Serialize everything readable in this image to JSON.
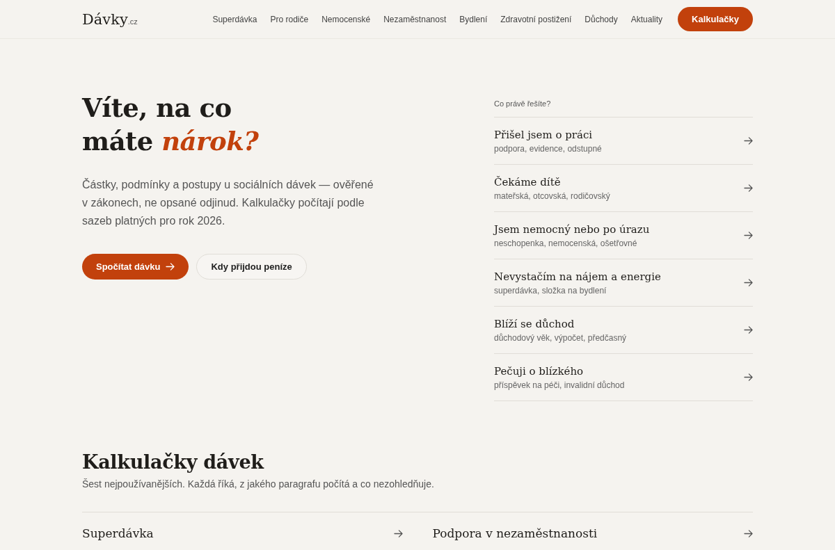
{
  "header": {
    "logo": "Dávky",
    "logo_suffix": ".cz",
    "nav": [
      {
        "label": "Superdávka",
        "kind": "link"
      },
      {
        "label": "Pro rodiče",
        "kind": "link"
      },
      {
        "label": "Nemocenské",
        "kind": "link"
      },
      {
        "label": "Nezaměstnanost",
        "kind": "link"
      },
      {
        "label": "Bydlení",
        "kind": "link"
      },
      {
        "label": "Zdravotní postižení",
        "kind": "link"
      },
      {
        "label": "Důchody",
        "kind": "link"
      },
      {
        "label": "Aktuality",
        "kind": "link"
      },
      {
        "label": "Kalkulačky",
        "kind": "cta"
      }
    ]
  },
  "hero": {
    "title": "Víte, na co máte *nárok?*",
    "lead": "Částky, podmínky a postupy u sociálních dávek — ověřené v zákonech, ne opsané odjinud. Kalkulačky počítají podle sazeb platných pro rok 2026.",
    "buttons": [
      {
        "label": "Spočítat dávku",
        "kind": "primary"
      },
      {
        "label": "Kdy přijdou peníze",
        "kind": "secondary"
      }
    ]
  },
  "situations": {
    "heading": "Co právě řešíte?",
    "items": [
      {
        "title": "Přišel jsem o práci",
        "tags": "podpora, evidence, odstupné"
      },
      {
        "title": "Čekáme dítě",
        "tags": "mateřská, otcovská, rodičovský"
      },
      {
        "title": "Jsem nemocný nebo po úrazu",
        "tags": "neschopenka, nemocenská, ošetřovné"
      },
      {
        "title": "Nevystačím na nájem a energie",
        "tags": "superdávka, složka na bydlení"
      },
      {
        "title": "Blíží se důchod",
        "tags": "důchodový věk, výpočet, předčasný"
      },
      {
        "title": "Pečuji o blízkého",
        "tags": "příspěvek na péči, invalidní důchod"
      }
    ]
  },
  "calculators": {
    "title": "Kalkulačky dávek",
    "subtitle": "Šest nejpoužívanějších. Každá říká, z jakého paragrafu počítá a co nezohledňuje.",
    "items": [
      {
        "title": "Superdávka"
      },
      {
        "title": "Podpora v nezaměstnanosti"
      }
    ]
  }
}
